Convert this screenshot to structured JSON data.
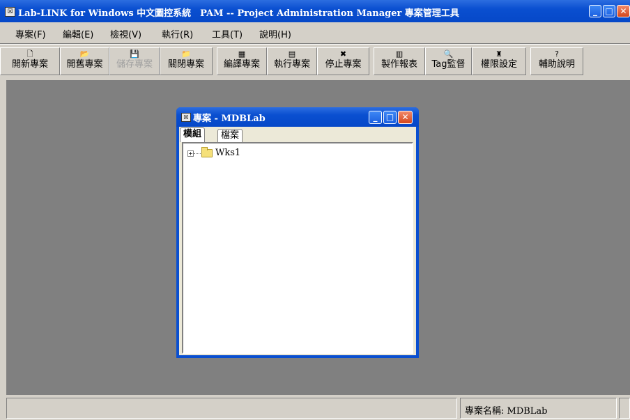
{
  "window": {
    "title": "Lab-LINK for Windows 中文圖控系統　PAM -- Project Administration Manager 專案管理工具"
  },
  "menu": [
    "專案(F)",
    "編輯(E)",
    "檢視(V)",
    "執行(R)",
    "工具(T)",
    "說明(H)"
  ],
  "toolbar": [
    {
      "label": "開新專案",
      "icon": "new-document-icon",
      "glyph": "🗋",
      "enabled": true
    },
    {
      "label": "開舊專案",
      "icon": "open-folder-icon",
      "glyph": "📂",
      "enabled": true
    },
    {
      "label": "儲存專案",
      "icon": "save-disk-icon",
      "glyph": "💾",
      "enabled": false
    },
    {
      "label": "關閉專案",
      "icon": "close-folder-icon",
      "glyph": "📁",
      "enabled": true
    },
    {
      "label": "編譯專案",
      "icon": "compile-icon",
      "glyph": "▦",
      "enabled": true
    },
    {
      "label": "執行專案",
      "icon": "run-icon",
      "glyph": "▤",
      "enabled": true
    },
    {
      "label": "停止專案",
      "icon": "stop-icon",
      "glyph": "✖",
      "enabled": true
    },
    {
      "label": "製作報表",
      "icon": "report-icon",
      "glyph": "▥",
      "enabled": true
    },
    {
      "label": "Tag監督",
      "icon": "tag-monitor-icon",
      "glyph": "🔍",
      "enabled": true
    },
    {
      "label": "權限設定",
      "icon": "permission-icon",
      "glyph": "♜",
      "enabled": true
    },
    {
      "label": "輔助說明",
      "icon": "help-icon",
      "glyph": "?",
      "enabled": true
    }
  ],
  "child_window": {
    "title": "專案 - MDBLab",
    "tabs": [
      "模組",
      "檔案"
    ],
    "active_tab": "模組",
    "tree": [
      {
        "label": "Wks1",
        "expandable": true
      }
    ]
  },
  "statusbar": {
    "project_name": "專案名稱: MDBLab"
  },
  "colors": {
    "titlebar": "#0a4fd0",
    "workspace": "#808080",
    "face": "#d4d0c8"
  }
}
